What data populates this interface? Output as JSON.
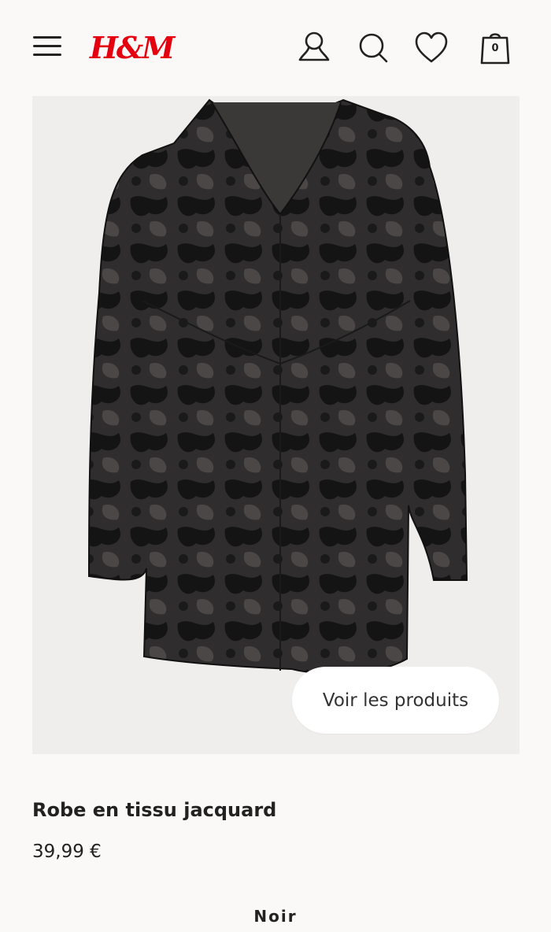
{
  "header": {
    "logo_text": "H&M",
    "bag_count": "0",
    "icons": [
      "menu-icon",
      "user-icon",
      "search-icon",
      "heart-icon",
      "shopping-bag-icon"
    ],
    "brand_color": "#e50010"
  },
  "product": {
    "shop_button_label": "Voir les produits",
    "title": "Robe en tissu jacquard",
    "price": "39,99 €",
    "color": "Noir"
  }
}
